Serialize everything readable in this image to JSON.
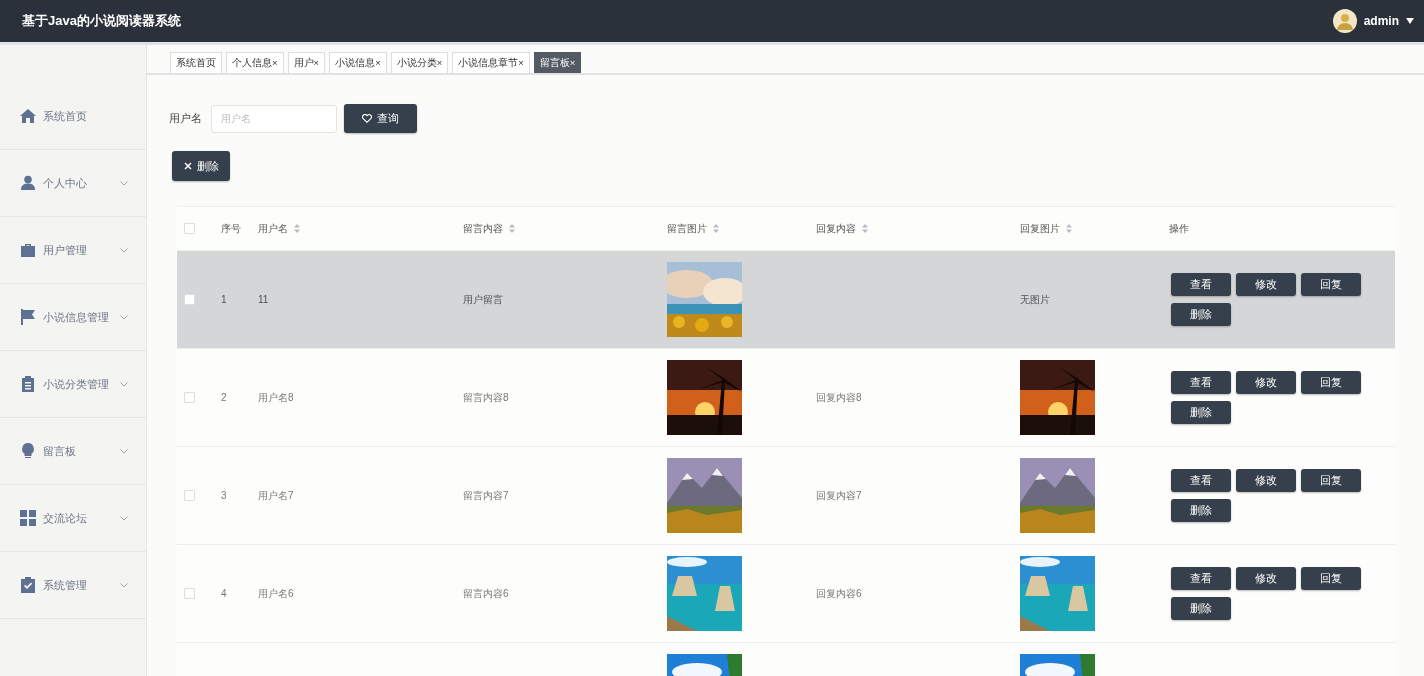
{
  "header": {
    "title": "基于Java的小说阅读器系统",
    "user": "admin"
  },
  "sidebar": {
    "items": [
      {
        "label": "系统首页",
        "expandable": false
      },
      {
        "label": "个人中心",
        "expandable": true
      },
      {
        "label": "用户管理",
        "expandable": true
      },
      {
        "label": "小说信息管理",
        "expandable": true
      },
      {
        "label": "小说分类管理",
        "expandable": true
      },
      {
        "label": "留言板",
        "expandable": true
      },
      {
        "label": "交流论坛",
        "expandable": true
      },
      {
        "label": "系统管理",
        "expandable": true
      }
    ]
  },
  "tabs": [
    {
      "label": "系统首页",
      "selected": false
    },
    {
      "label": "个人信息",
      "close": "×",
      "selected": false
    },
    {
      "label": "用户",
      "close": "×",
      "selected": false
    },
    {
      "label": "小说信息",
      "close": "×",
      "selected": false
    },
    {
      "label": "小说分类",
      "close": "×",
      "selected": false
    },
    {
      "label": "小说信息章节",
      "close": "×",
      "selected": false
    },
    {
      "label": "留言板",
      "close": "×",
      "selected": true
    }
  ],
  "search": {
    "label": "用户名",
    "placeholder": "用户名",
    "button": "查询"
  },
  "delete_button": "删除",
  "table": {
    "header_checked": false,
    "columns": [
      {
        "label": "序号",
        "sortable": false
      },
      {
        "label": "用户名",
        "sortable": true
      },
      {
        "label": "留言内容",
        "sortable": true
      },
      {
        "label": "留言图片",
        "sortable": true
      },
      {
        "label": "回复内容",
        "sortable": true
      },
      {
        "label": "回复图片",
        "sortable": true
      },
      {
        "label": "操作",
        "sortable": false
      }
    ],
    "rows": [
      {
        "highlighted": true,
        "checked": false,
        "index": "1",
        "username": "11",
        "content": "用户留言",
        "picture": {
          "kind": "picture"
        },
        "reply": "",
        "reply_picture": {
          "kind": "text",
          "text": "无图片"
        },
        "actions": [
          "查看",
          "修改",
          "回复",
          "删除"
        ]
      },
      {
        "highlighted": false,
        "checked": false,
        "index": "2",
        "username": "用户名8",
        "content": "留言内容8",
        "picture": {
          "kind": "picture"
        },
        "reply": "回复内容8",
        "reply_picture": {
          "kind": "picture"
        },
        "actions": [
          "查看",
          "修改",
          "回复",
          "删除"
        ]
      },
      {
        "highlighted": false,
        "checked": false,
        "index": "3",
        "username": "用户名7",
        "content": "留言内容7",
        "picture": {
          "kind": "picture"
        },
        "reply": "回复内容7",
        "reply_picture": {
          "kind": "picture"
        },
        "actions": [
          "查看",
          "修改",
          "回复",
          "删除"
        ]
      },
      {
        "highlighted": false,
        "checked": false,
        "index": "4",
        "username": "用户名6",
        "content": "留言内容6",
        "picture": {
          "kind": "picture"
        },
        "reply": "回复内容6",
        "reply_picture": {
          "kind": "picture"
        },
        "actions": [
          "查看",
          "修改",
          "回复",
          "删除"
        ]
      },
      {
        "highlighted": false,
        "picture": {
          "kind": "picture"
        },
        "reply_picture": {
          "kind": "picture"
        }
      }
    ]
  }
}
